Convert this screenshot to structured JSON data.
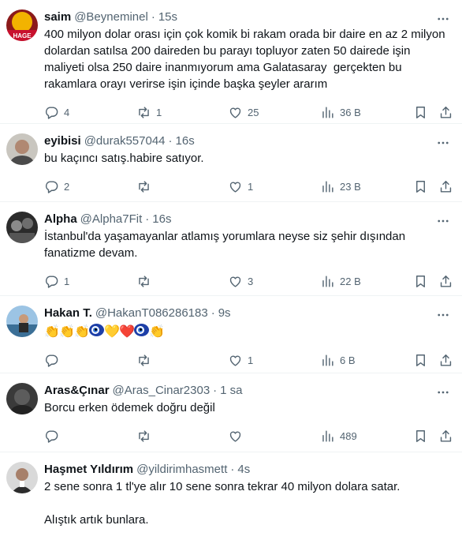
{
  "tweets": [
    {
      "name": "saim",
      "handle": "@Beyneminel",
      "time": "15s",
      "text": "400 milyon dolar orası için çok komik bi rakam orada bir daire en az 2 milyon dolardan satılsa 200 daireden bu parayı topluyor zaten 50 dairede işin maliyeti olsa 250 daire inanmıyorum ama Galatasaray  gerçekten bu rakamlara orayı verirse işin içinde başka şeyler ararım",
      "replies": "4",
      "retweets": "1",
      "likes": "25",
      "views": "36 B",
      "avatar_label": "HAGE"
    },
    {
      "name": "eyibisi",
      "handle": "@durak557044",
      "time": "16s",
      "text": "bu kaçıncı satış.habire satıyor.",
      "replies": "2",
      "retweets": "",
      "likes": "1",
      "views": "23 B"
    },
    {
      "name": "Alpha",
      "handle": "@Alpha7Fit",
      "time": "16s",
      "text": "İstanbul'da yaşamayanlar atlamış yorumlara neyse siz şehir dışından fanatizme devam.",
      "replies": "1",
      "retweets": "",
      "likes": "3",
      "views": "22 B"
    },
    {
      "name": "Hakan T.",
      "handle": "@HakanT086286183",
      "time": "9s",
      "emojis": [
        "👏",
        "👏",
        "👏",
        "nazar",
        "💛",
        "❤️",
        "nazar",
        "👏"
      ],
      "replies": "",
      "retweets": "",
      "likes": "1",
      "views": "6 B"
    },
    {
      "name": "Aras&Çınar",
      "handle": "@Aras_Cinar2303",
      "time": "1 sa",
      "text": "Borcu erken ödemek doğru değil",
      "replies": "",
      "retweets": "",
      "likes": "",
      "views": "489"
    },
    {
      "name": "Haşmet Yıldırım",
      "handle": "@yildirimhasmett",
      "time": "4s",
      "text": "2 sene sonra 1 tl'ye alır 10 sene sonra tekrar 40 milyon dolara satar.\n\nAlıştık artık bunlara."
    }
  ],
  "separator": "·",
  "colors": {
    "text": "#0f1419",
    "muted": "#536471",
    "border": "#eff3f4"
  }
}
